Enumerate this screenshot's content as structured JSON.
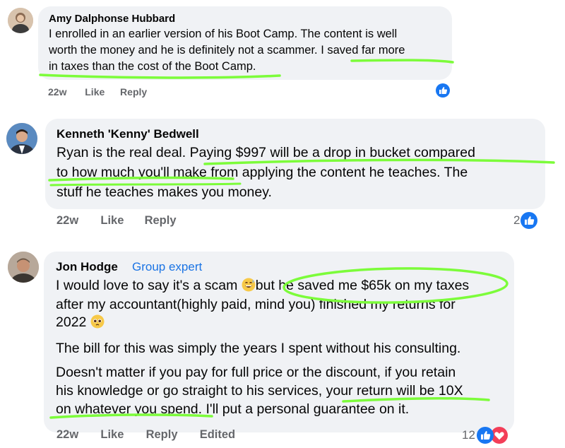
{
  "comments": [
    {
      "author": "Amy Dalphonse Hubbard",
      "lines": [
        "I enrolled in an earlier version of his Boot Camp. The content is well",
        "worth the money and he is definitely not a scammer. I saved far more",
        "in taxes than the cost of the Boot Camp."
      ],
      "time": "22w",
      "like_label": "Like",
      "reply_label": "Reply"
    },
    {
      "author": "Kenneth 'Kenny' Bedwell",
      "lines": [
        "Ryan is the real deal. Paying $997 will be a drop in bucket compared",
        "to how much you'll make from applying the content he teaches. The",
        "stuff he teaches makes you money."
      ],
      "time": "22w",
      "like_label": "Like",
      "reply_label": "Reply",
      "reaction_count": "2"
    },
    {
      "author": "Jon Hodge",
      "badge": "Group expert",
      "line1_a": "I would love to say it's a scam ",
      "line1_b": "but he saved me $65k on my taxes",
      "line2": "after my accountant(highly paid, mind you) finished my returns for",
      "line3": "2022 ",
      "para2": "The bill for this was simply the years I spent without his consulting.",
      "para3_lines": [
        "Doesn't matter if you pay for full price or the discount, if you retain",
        "his knowledge or go straight to his services, your return will be 10X",
        "on whatever you spend. I'll put a personal guarantee on it."
      ],
      "time": "22w",
      "like_label": "Like",
      "reply_label": "Reply",
      "edited_label": "Edited",
      "reaction_count": "12"
    }
  ],
  "icons": {
    "like": "like-icon",
    "love": "love-icon",
    "grin": "grinning-sweat-emoji",
    "pleading": "pleading-face-emoji"
  },
  "colors": {
    "highlight": "#7CFC3A",
    "bubble": "#f0f2f5",
    "link_blue": "#1b74e4",
    "like_blue": "#1877f2",
    "love_red": "#f33e58"
  }
}
